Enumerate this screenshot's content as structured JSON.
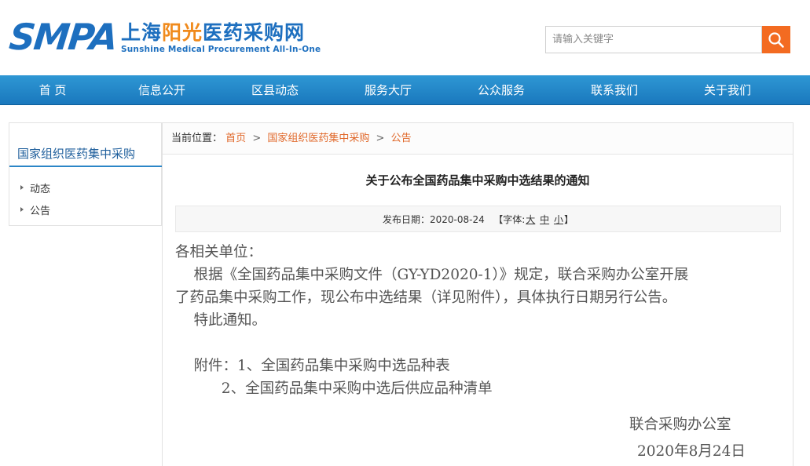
{
  "header": {
    "logo_smpa": "SMPA",
    "logo_cn_part1": "上海",
    "logo_cn_part2": "阳光",
    "logo_cn_part3": "医药采购网",
    "logo_en": "Sunshine Medical Procurement All-In-One",
    "search_placeholder": "请输入关键字",
    "search_icon": "search-icon"
  },
  "nav": {
    "items": [
      "首 页",
      "信息公开",
      "区县动态",
      "服务大厅",
      "公众服务",
      "联系我们",
      "关于我们"
    ]
  },
  "sidebar": {
    "title": "国家组织医药集中采购",
    "items": [
      "动态",
      "公告"
    ]
  },
  "breadcrumb": {
    "prefix": "当前位置：",
    "items": [
      "首页",
      "国家组织医药集中采购",
      "公告"
    ],
    "separator": ">"
  },
  "article": {
    "title": "关于公布全国药品集中采购中选结果的通知",
    "meta_date_label": "发布日期：2020-08-24",
    "meta_font_prefix": "【字体:",
    "font_large": "大",
    "font_medium": "中",
    "font_small": "小",
    "meta_font_suffix": "】",
    "lines": [
      "各相关单位：",
      "    根据《全国药品集中采购文件（GY-YD2020-1）》规定，联合采购办公室开展",
      "了药品集中采购工作，现公布中选结果（详见附件），具体执行日期另行公告。",
      "    特此通知。",
      "",
      "    附件：1、全国药品集中采购中选品种表",
      "          2、全国药品集中采购中选后供应品种清单"
    ],
    "signature": "联合采购办公室",
    "date": "2020年8月24日"
  },
  "colors": {
    "brand_blue": "#1d6fbf",
    "brand_orange": "#f08a1c",
    "nav_blue": "#1a78bd",
    "search_button": "#f36b21",
    "breadcrumb_link": "#e0682a"
  }
}
